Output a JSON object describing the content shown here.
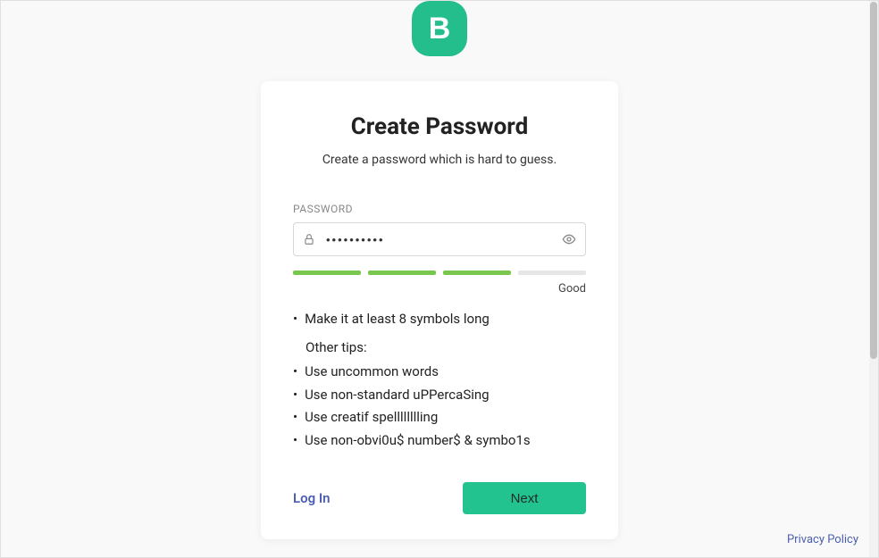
{
  "logo": {
    "letter": "B"
  },
  "card": {
    "title": "Create Password",
    "subtitle": "Create a password which is hard to guess.",
    "password_field": {
      "label": "PASSWORD",
      "value": "••••••••••"
    },
    "strength": {
      "filled_segments": 3,
      "total_segments": 4,
      "label": "Good"
    },
    "tips": {
      "main_rule": "Make it at least 8 symbols long",
      "other_label": "Other tips:",
      "items": [
        "Use uncommon words",
        "Use non-standard uPPercaSing",
        "Use creatif spelllllllling",
        "Use non-obvi0u$ number$ & symbo1s"
      ]
    },
    "actions": {
      "login": "Log In",
      "next": "Next"
    }
  },
  "footer": {
    "privacy": "Privacy Policy"
  }
}
